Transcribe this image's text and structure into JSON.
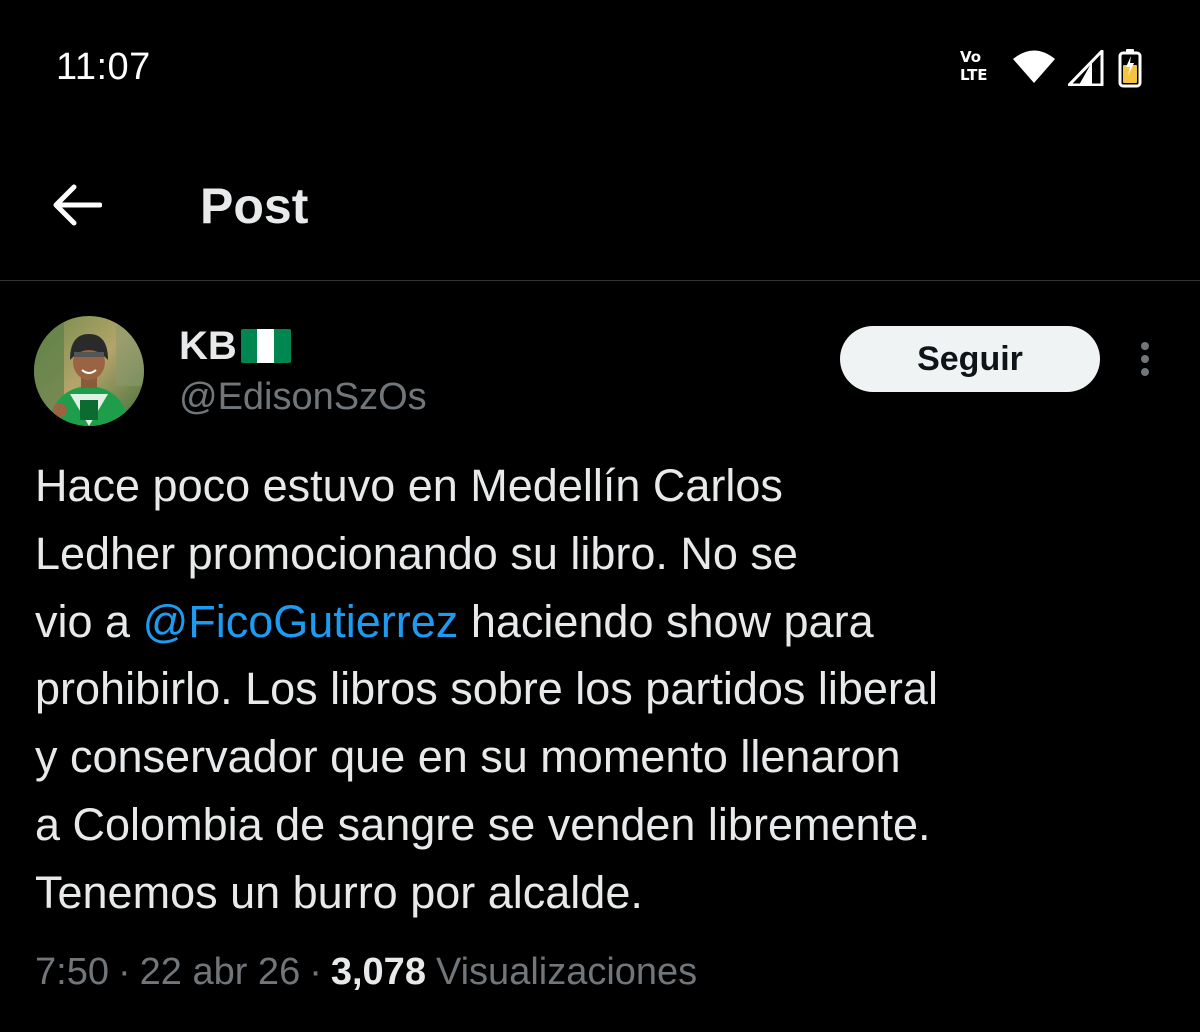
{
  "status_bar": {
    "time": "11:07",
    "volte_top": "Vo",
    "volte_bottom": "LTE",
    "icons": [
      "volte-icon",
      "wifi-icon",
      "signal-icon",
      "battery-icon"
    ]
  },
  "header": {
    "title": "Post",
    "back_icon": "arrow-left-icon"
  },
  "author": {
    "display_name": "KB",
    "flag_icon": "green-white-green-flag-emoji",
    "username": "@EdisonSzOs",
    "avatar_icon": "profile-photo"
  },
  "follow_button": {
    "label": "Seguir"
  },
  "more_icon": "vertical-ellipsis-icon",
  "tweet": {
    "lines": [
      "Hace poco estuvo en Medellín Carlos",
      "Ledher promocionando su libro. No se",
      "haciendo show para",
      "prohibirlo. Los libros sobre los partidos liberal",
      "y conservador que en su momento llenaron",
      "a Colombia de sangre se venden libremente.",
      "Tenemos un burro por alcalde."
    ],
    "line3_prefix": "vio a ",
    "mention": "@FicoGutierrez",
    "line3_suffix": " haciendo show para"
  },
  "meta": {
    "time": "7:50",
    "separator": "·",
    "date": "22 abr 26",
    "views_count": "3,078",
    "views_label": "Visualizaciones"
  },
  "colors": {
    "background": "#000000",
    "text_primary": "#e7e9ea",
    "text_secondary": "#71767b",
    "link": "#1d9bf0",
    "divider": "#2f3336",
    "follow_button_bg": "#eff3f4",
    "follow_button_text": "#0f1419",
    "flag_green": "#008751",
    "flag_white": "#ffffff",
    "battery_fill": "#f5c542"
  }
}
